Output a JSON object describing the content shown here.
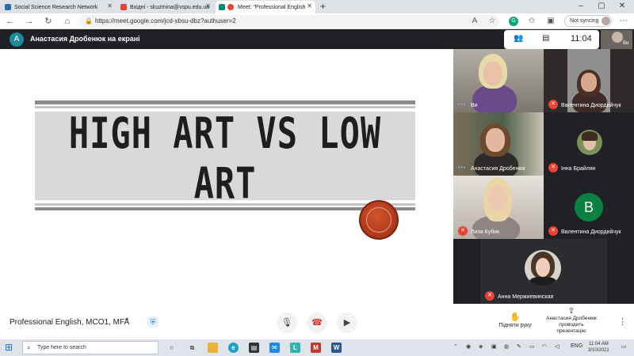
{
  "browser": {
    "tabs": [
      {
        "label": "Social Science Research Network",
        "favicon_color": "#2b6cb0"
      },
      {
        "label": "Вхідні - skuzmina@vspu.edu.ua",
        "favicon_color": "#ea4335"
      },
      {
        "label": "Meet: \"Professional English",
        "favicon_color": "#00897b"
      }
    ],
    "new_tab": "+",
    "url": "https://meet.google.com/jcd-xbsu-dbz?authuser=2",
    "profile_label": "Not syncing"
  },
  "meet": {
    "presenter_initial": "A",
    "presenter_banner": "Анастасия Дробенюк на екрані",
    "time": "11:04",
    "self_label": "Ви",
    "slide": {
      "title": "HIGH ART VS LOW ART"
    },
    "participants": [
      {
        "name": "Ви",
        "muted": false
      },
      {
        "name": "Валентина Диордийчук",
        "muted": true
      },
      {
        "name": "Анастасия Дробенюк",
        "muted": false
      },
      {
        "name": "Інна Брайлян",
        "muted": true
      },
      {
        "name": "Лиза Кубик",
        "muted": true
      },
      {
        "name": "Валентина Диордийчук",
        "muted": true,
        "initial": "B"
      },
      {
        "name": "Анна Мержиевинская",
        "muted": true
      }
    ],
    "controls": {
      "meeting_name": "Professional English, MCO1, MFA",
      "raise_hand": "Підняти руку",
      "present_line1": "Анастасия Дробенюк",
      "present_line2": "проводить презентацію"
    }
  },
  "taskbar": {
    "search_placeholder": "Type here to search",
    "lang": "ENG",
    "clock_time": "11:04 AM",
    "clock_date": "3/10/2021"
  },
  "colors": {
    "meet_dark": "#202124",
    "mic_off_red": "#ea4335",
    "avatar_green": "#0b8043",
    "presenter_teal": "#1a8a9a"
  }
}
